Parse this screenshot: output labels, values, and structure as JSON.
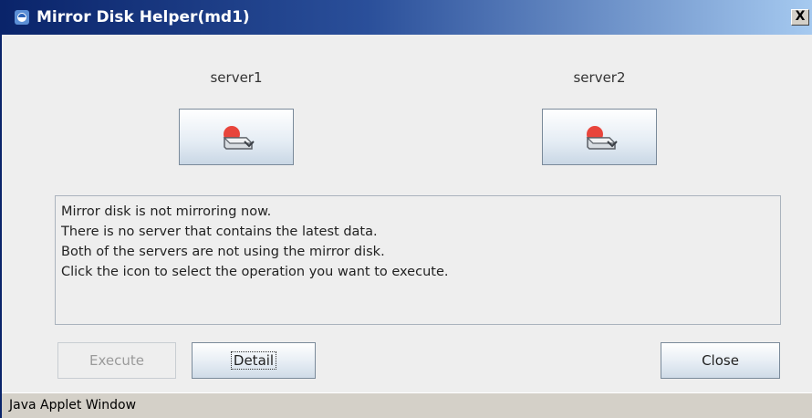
{
  "window": {
    "title": "Mirror Disk Helper(md1)",
    "close_glyph": "X",
    "icon": "window-app-icon"
  },
  "servers": [
    {
      "name": "server1",
      "icon": "disk-error-icon"
    },
    {
      "name": "server2",
      "icon": "disk-error-icon"
    }
  ],
  "message": {
    "lines": [
      "Mirror disk is not mirroring now.",
      "There is no server that contains the latest data.",
      "Both of the servers are not using the mirror disk.",
      "Click the icon to select the operation you want to execute."
    ]
  },
  "buttons": {
    "execute_label": "Execute",
    "detail_label": "Detail",
    "close_label": "Close"
  },
  "status": {
    "text": "Java Applet Window"
  },
  "colors": {
    "titlebar_start": "#0a246a",
    "titlebar_end": "#a6caf0",
    "disk_error_red": "#e8453c"
  }
}
